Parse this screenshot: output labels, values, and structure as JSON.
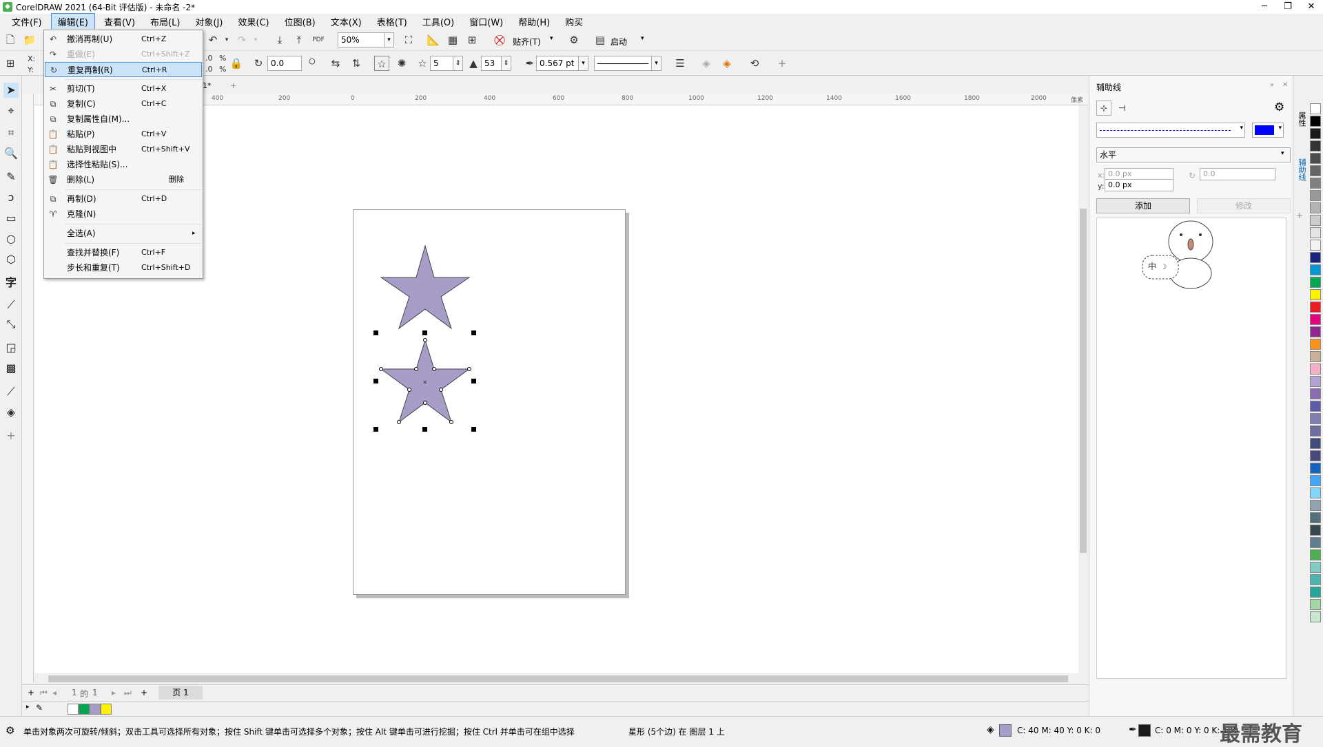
{
  "window": {
    "title": "CorelDRAW 2021 (64-Bit 评估版) - 未命名 -2*",
    "min": "─",
    "max": "❐",
    "close": "✕"
  },
  "menu": [
    "文件(F)",
    "编辑(E)",
    "查看(V)",
    "布局(L)",
    "对象(J)",
    "效果(C)",
    "位图(B)",
    "文本(X)",
    "表格(T)",
    "工具(O)",
    "窗口(W)",
    "帮助(H)",
    "购买"
  ],
  "toolbar": {
    "zoom": "50%",
    "snap_label": "贴齐(T)",
    "launch_label": "启动",
    "rotate": "0.0",
    "points": "5",
    "sharpness": "53",
    "outline": "0.567 pt",
    "x_label": "X:",
    "y_label": "Y:",
    "pct1": "%",
    "pct2": "%",
    "v1": ".0",
    "v2": ".0"
  },
  "edit_menu": [
    {
      "icon": "↶",
      "label": "撤消再制(U)",
      "shortcut": "Ctrl+Z",
      "disabled": false
    },
    {
      "icon": "↷",
      "label": "重做(E)",
      "shortcut": "Ctrl+Shift+Z",
      "disabled": true
    },
    {
      "icon": "↻",
      "label": "重复再制(R)",
      "shortcut": "Ctrl+R",
      "disabled": false,
      "highlight": true
    },
    {
      "icon": "✂",
      "label": "剪切(T)",
      "shortcut": "Ctrl+X",
      "disabled": false
    },
    {
      "icon": "⧉",
      "label": "复制(C)",
      "shortcut": "Ctrl+C",
      "disabled": false
    },
    {
      "icon": "⧉",
      "label": "复制属性自(M)...",
      "shortcut": "",
      "disabled": false
    },
    {
      "icon": "📋",
      "label": "粘贴(P)",
      "shortcut": "Ctrl+V",
      "disabled": false
    },
    {
      "icon": "📋",
      "label": "粘贴到视图中",
      "shortcut": "Ctrl+Shift+V",
      "disabled": false
    },
    {
      "icon": "📋",
      "label": "选择性粘贴(S)...",
      "shortcut": "",
      "disabled": false
    },
    {
      "icon": "🗑",
      "label": "删除(L)",
      "shortcut": "删除",
      "disabled": false
    },
    {
      "icon": "⧉",
      "label": "再制(D)",
      "shortcut": "Ctrl+D",
      "disabled": false
    },
    {
      "icon": "♈",
      "label": "克隆(N)",
      "shortcut": "",
      "disabled": false
    },
    {
      "icon": "",
      "label": "全选(A)",
      "shortcut": "▸",
      "disabled": false
    },
    {
      "icon": "",
      "label": "查找并替换(F)",
      "shortcut": "Ctrl+F",
      "disabled": false
    },
    {
      "icon": "",
      "label": "步长和重复(T)",
      "shortcut": "Ctrl+Shift+D",
      "disabled": false
    }
  ],
  "ruler": {
    "unit": "像素",
    "ticks": [
      "400",
      "200",
      "0",
      "200",
      "400",
      "600",
      "800",
      "1000",
      "1200",
      "1400",
      "1600",
      "1800",
      "2000"
    ]
  },
  "tab": {
    "name": "-1*",
    "add": "+"
  },
  "docker": {
    "title": "辅助线",
    "orientation": "水平",
    "x": "0.0 px",
    "y": "0.0 px",
    "angle": "0.0",
    "add": "添加",
    "modify": "修改",
    "x_label": "x:",
    "y_label": "y:",
    "line_color": "#0000ff"
  },
  "dockertabs": [
    "属性",
    "辅助线"
  ],
  "pagenav": {
    "current": "1",
    "of": "的",
    "total": "1",
    "page_tab": "页 1"
  },
  "status": {
    "hint": "单击对象两次可旋转/倾斜；双击工具可选择所有对象；按住 Shift 键单击可选择多个对象；按住 Alt 键单击可进行挖掘；按住 Ctrl 并单击可在组中选择",
    "object": "星形 (5个边) 在 图层 1 上",
    "fill_cmyk": "C: 40 M: 40 Y: 0 K: 0",
    "outline_cmyk": "C: 0 M: 0 Y: 0 K: 100"
  },
  "watermark": "最需教育",
  "colors": {
    "star": "#a89cc8",
    "selection": "#000000"
  },
  "palette": [
    "#ffffff",
    "#000000",
    "#1a1a1a",
    "#333333",
    "#4d4d4d",
    "#666666",
    "#808080",
    "#999999",
    "#b3b3b3",
    "#cccccc",
    "#e6e6e6",
    "#f2f2f2",
    "#1a237e",
    "#0097d7",
    "#00a651",
    "#fff200",
    "#ed1c24",
    "#e4007f",
    "#92278f",
    "#f7941d",
    "#c7b299",
    "#f6adc6",
    "#b3a4d4",
    "#8c6bb1",
    "#5b5ea6",
    "#7f7fb4",
    "#6d6e9f",
    "#3f4f7a",
    "#4a4a7a",
    "#1565c0",
    "#42a5f5",
    "#81d4fa",
    "#90a4ae",
    "#546e7a",
    "#37474f",
    "#607d8b",
    "#4caf50",
    "#80cbc4",
    "#4db6ac",
    "#26a69a",
    "#a5d6a7",
    "#c8e6c9"
  ],
  "doc_palette": [
    "#ffffff",
    "#00a651",
    "#a89cc8",
    "#fff200"
  ]
}
